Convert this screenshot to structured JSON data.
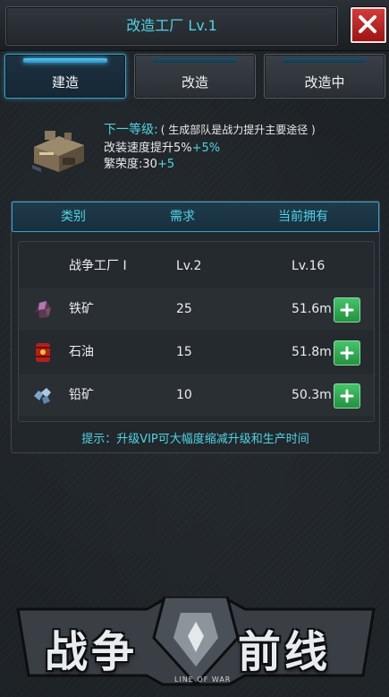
{
  "header": {
    "title": "改造工厂 Lv.1"
  },
  "tabs": [
    {
      "label": "建造",
      "active": true
    },
    {
      "label": "改造",
      "active": false
    },
    {
      "label": "改造中",
      "active": false
    }
  ],
  "upgrade": {
    "next_label": "下一等级:",
    "note": "( 生成部队是战力提升主要途径 )",
    "speed_label": "改装速度提升5%",
    "speed_bonus": "+5%",
    "prosperity_label": "繁荣度:30",
    "prosperity_bonus": "+5"
  },
  "table": {
    "headers": [
      "类别",
      "需求",
      "当前拥有"
    ],
    "rows": [
      {
        "icon": "factory-none",
        "name": "战争工厂 I",
        "required": "Lv.2",
        "owned": "Lv.16",
        "addable": false
      },
      {
        "icon": "iron-ore-icon",
        "name": "铁矿",
        "required": "25",
        "owned": "51.6m",
        "addable": true
      },
      {
        "icon": "oil-barrel-icon",
        "name": "石油",
        "required": "15",
        "owned": "51.8m",
        "addable": true
      },
      {
        "icon": "lead-ore-icon",
        "name": "铅矿",
        "required": "10",
        "owned": "50.3m",
        "addable": true
      }
    ]
  },
  "tip": "提示：升级VIP可大幅度缩减升级和生产时间",
  "logo": {
    "left": "战争",
    "right": "前线",
    "sub": "LINE OF WAR"
  },
  "colors": {
    "accent": "#4fd4e3",
    "close": "#c42a2a",
    "add": "#33b357"
  }
}
